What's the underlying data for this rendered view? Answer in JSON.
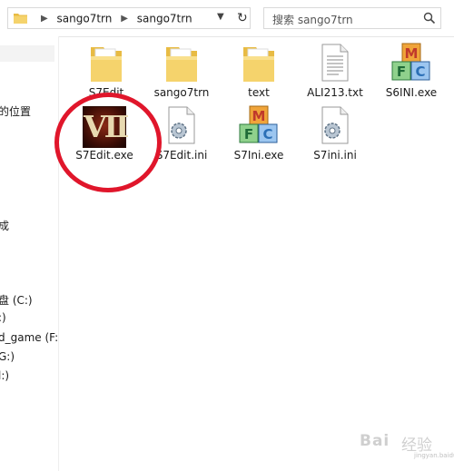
{
  "address_bar": {
    "crumbs": [
      "sango7trn",
      "sango7trn"
    ]
  },
  "search": {
    "placeholder": "搜索 sango7trn"
  },
  "nav_pane": {
    "items": [
      "的位置",
      "成",
      "盘 (C:)",
      ":)",
      "d_game (F:)",
      "G:)",
      "l:)"
    ]
  },
  "files": [
    {
      "name": "S7Edit",
      "type": "folder",
      "icon": "folder-icon"
    },
    {
      "name": "sango7trn",
      "type": "folder",
      "icon": "folder-icon"
    },
    {
      "name": "text",
      "type": "folder",
      "icon": "folder-icon"
    },
    {
      "name": "ALI213.txt",
      "type": "text-file",
      "icon": "text-file-icon"
    },
    {
      "name": "S6INI.exe",
      "type": "exe",
      "icon": "mfc-app-icon"
    },
    {
      "name": "S7Edit.exe",
      "type": "exe",
      "icon": "vii-app-icon",
      "icon_text": "VII"
    },
    {
      "name": "S7Edit.ini",
      "type": "settings",
      "icon": "settings-file-icon"
    },
    {
      "name": "S7Ini.exe",
      "type": "exe",
      "icon": "mfc-app-icon"
    },
    {
      "name": "S7ini.ini",
      "type": "settings",
      "icon": "settings-file-icon"
    }
  ],
  "annotation": {
    "color": "#e0162b"
  },
  "watermark": {
    "brand": "Bai",
    "brand2": "经验",
    "url": "jingyan.baidu.com"
  },
  "colors": {
    "folder": "#f5d36c",
    "folder_dark": "#e8bb43",
    "mfc_m": "#c0392b",
    "mfc_f": "#2e8b57",
    "mfc_c": "#2b6fb6"
  }
}
